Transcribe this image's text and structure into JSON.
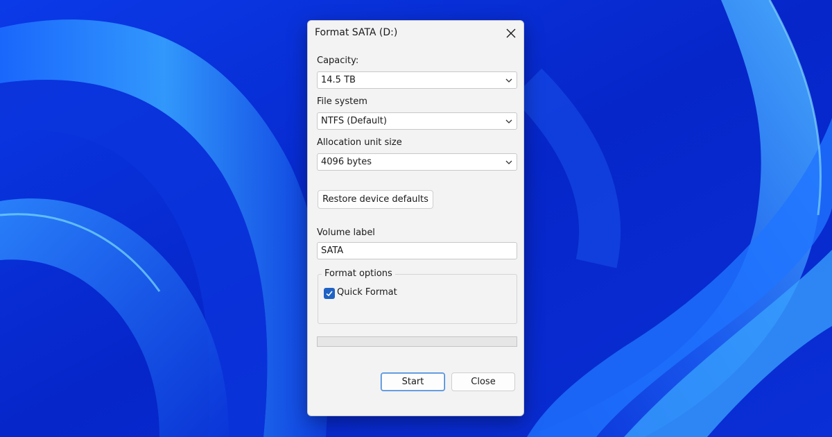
{
  "dialog": {
    "title": "Format SATA (D:)",
    "capacity": {
      "label": "Capacity:",
      "value": "14.5 TB"
    },
    "file_system": {
      "label": "File system",
      "value": "NTFS (Default)"
    },
    "allocation": {
      "label": "Allocation unit size",
      "value": "4096 bytes"
    },
    "restore_label": "Restore device defaults",
    "volume": {
      "label": "Volume label",
      "value": "SATA"
    },
    "format_options": {
      "legend": "Format options",
      "quick_format_label": "Quick Format",
      "quick_format_checked": true
    },
    "progress": 0,
    "start_label": "Start",
    "close_label": "Close"
  },
  "colors": {
    "accent": "#1f62c4",
    "wallpaper": "#0a2fd6"
  },
  "icons": {
    "close": "close-icon",
    "chevron": "chevron-down-icon",
    "check": "checkmark-icon"
  }
}
